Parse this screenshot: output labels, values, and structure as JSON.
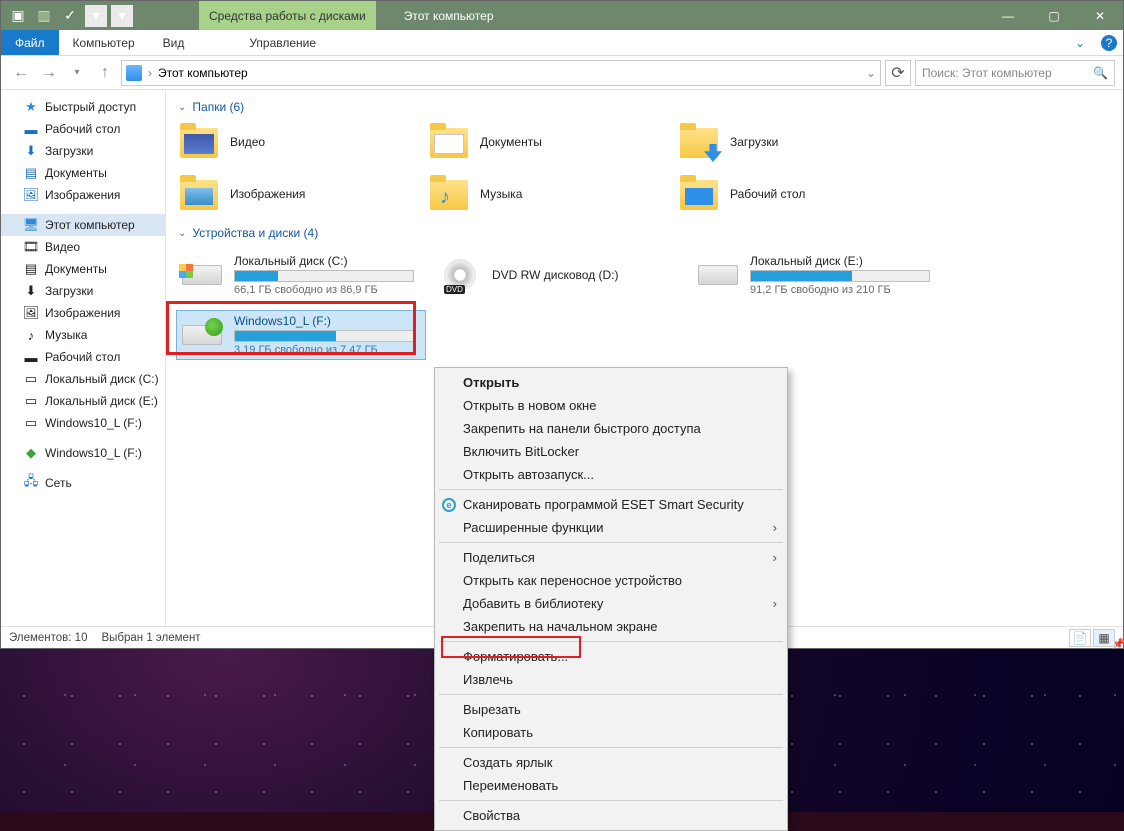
{
  "titlebar": {
    "contextual_tab": "Средства работы с дисками",
    "title": "Этот компьютер"
  },
  "ribbon": {
    "file": "Файл",
    "computer": "Компьютер",
    "view": "Вид",
    "manage": "Управление"
  },
  "address": {
    "location": "Этот компьютер"
  },
  "search": {
    "placeholder": "Поиск: Этот компьютер"
  },
  "nav": {
    "quick_access": "Быстрый доступ",
    "desktop": "Рабочий стол",
    "downloads": "Загрузки",
    "documents": "Документы",
    "pictures": "Изображения",
    "this_pc": "Этот компьютер",
    "videos": "Видео",
    "documents2": "Документы",
    "downloads2": "Загрузки",
    "pictures2": "Изображения",
    "music": "Музыка",
    "desktop2": "Рабочий стол",
    "local_c": "Локальный диск (C:)",
    "local_e": "Локальный диск (E:)",
    "win10_f": "Windows10_L (F:)",
    "win10_f2": "Windows10_L (F:)",
    "network": "Сеть"
  },
  "groups": {
    "folders": "Папки (6)",
    "drives": "Устройства и диски (4)"
  },
  "folders": {
    "videos": "Видео",
    "documents": "Документы",
    "downloads": "Загрузки",
    "pictures": "Изображения",
    "music": "Музыка",
    "desktop": "Рабочий стол"
  },
  "drives": {
    "c": {
      "name": "Локальный диск (C:)",
      "sub": "66,1 ГБ свободно из 86,9 ГБ",
      "fill": 24
    },
    "d": {
      "name": "DVD RW дисковод (D:)"
    },
    "e": {
      "name": "Локальный диск (E:)",
      "sub": "91,2 ГБ свободно из 210 ГБ",
      "fill": 57
    },
    "f": {
      "name": "Windows10_L (F:)",
      "sub": "3,19 ГБ свободно из 7,47 ГБ",
      "fill": 57
    }
  },
  "status": {
    "count": "Элементов: 10",
    "selected": "Выбран 1 элемент"
  },
  "ctx": {
    "open": "Открыть",
    "open_new": "Открыть в новом окне",
    "pin_quick": "Закрепить на панели быстрого доступа",
    "bitlocker": "Включить BitLocker",
    "autoplay": "Открыть автозапуск...",
    "eset": "Сканировать программой ESET Smart Security",
    "adv": "Расширенные функции",
    "share": "Поделиться",
    "portable": "Открыть как переносное устройство",
    "library": "Добавить в библиотеку",
    "start_pin": "Закрепить на начальном экране",
    "format": "Форматировать...",
    "eject": "Извлечь",
    "cut": "Вырезать",
    "copy": "Копировать",
    "shortcut": "Создать ярлык",
    "rename": "Переименовать",
    "properties": "Свойства"
  }
}
